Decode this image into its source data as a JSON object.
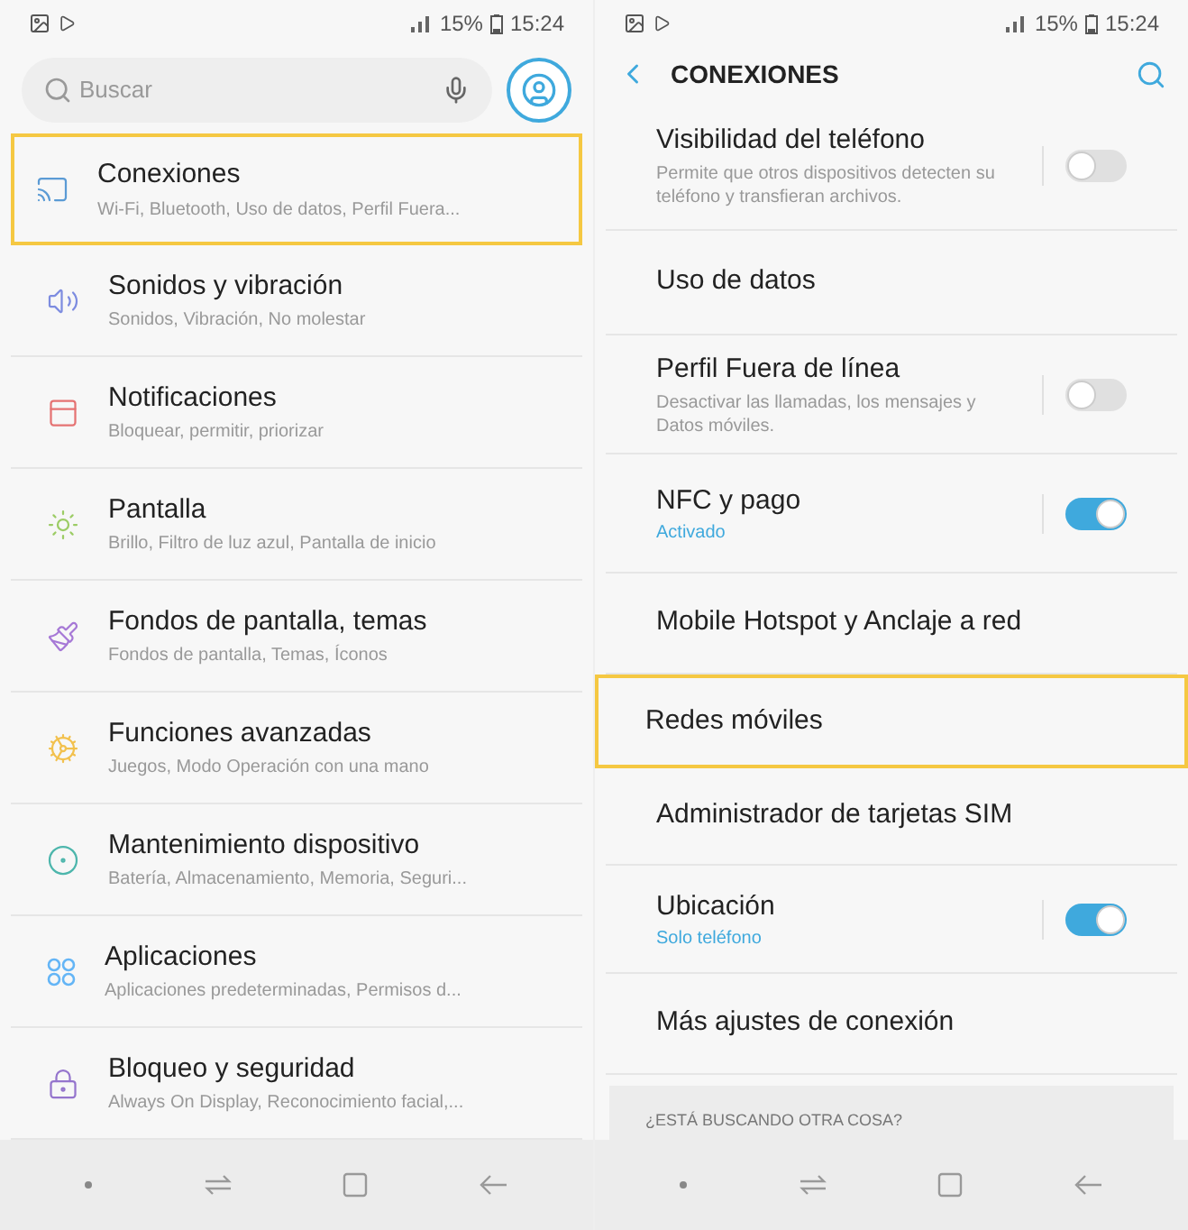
{
  "left_screen": {
    "status_bar": {
      "battery": "15%",
      "time": "15:24"
    },
    "search": {
      "placeholder": "Buscar"
    },
    "items": [
      {
        "title": "Conexiones",
        "subtitle": "Wi-Fi, Bluetooth, Uso de datos, Perfil Fuera...",
        "highlighted": true
      },
      {
        "title": "Sonidos y vibración",
        "subtitle": "Sonidos, Vibración, No molestar",
        "highlighted": false
      },
      {
        "title": "Notificaciones",
        "subtitle": "Bloquear, permitir, priorizar",
        "highlighted": false
      },
      {
        "title": "Pantalla",
        "subtitle": "Brillo, Filtro de luz azul, Pantalla de inicio",
        "highlighted": false
      },
      {
        "title": "Fondos de pantalla, temas",
        "subtitle": "Fondos de pantalla, Temas, Íconos",
        "highlighted": false
      },
      {
        "title": "Funciones avanzadas",
        "subtitle": "Juegos, Modo Operación con una mano",
        "highlighted": false
      },
      {
        "title": "Mantenimiento dispositivo",
        "subtitle": "Batería, Almacenamiento, Memoria, Seguri...",
        "highlighted": false
      },
      {
        "title": "Aplicaciones",
        "subtitle": "Aplicaciones predeterminadas, Permisos d...",
        "highlighted": false
      },
      {
        "title": "Bloqueo y seguridad",
        "subtitle": "Always On Display, Reconocimiento facial,...",
        "highlighted": false
      }
    ]
  },
  "right_screen": {
    "status_bar": {
      "battery": "15%",
      "time": "15:24"
    },
    "title": "CONEXIONES",
    "items": [
      {
        "kind": "toggle",
        "title": "Visibilidad del teléfono",
        "subtitle": "Permite que otros dispositivos detecten su teléfono y transfieran archivos.",
        "on": false,
        "highlighted": false
      },
      {
        "kind": "plain",
        "title": "Uso de datos",
        "highlighted": false
      },
      {
        "kind": "toggle",
        "title": "Perfil Fuera de línea",
        "subtitle": "Desactivar las llamadas, los mensajes y Datos móviles.",
        "on": false,
        "highlighted": false
      },
      {
        "kind": "toggle",
        "title": "NFC y pago",
        "subtitle": "Activado",
        "on": true,
        "highlighted": false
      },
      {
        "kind": "plain",
        "title": "Mobile Hotspot y Anclaje a red",
        "highlighted": false
      },
      {
        "kind": "plain",
        "title": "Redes móviles",
        "highlighted": true
      },
      {
        "kind": "plain",
        "title": "Administrador de tarjetas SIM",
        "highlighted": false
      },
      {
        "kind": "toggle",
        "title": "Ubicación",
        "subtitle": "Solo teléfono",
        "on": true,
        "highlighted": false
      },
      {
        "kind": "plain",
        "title": "Más ajustes de conexión",
        "highlighted": false
      }
    ],
    "suggestion_card": {
      "heading": "¿ESTÁ BUSCANDO OTRA COSA?"
    }
  }
}
